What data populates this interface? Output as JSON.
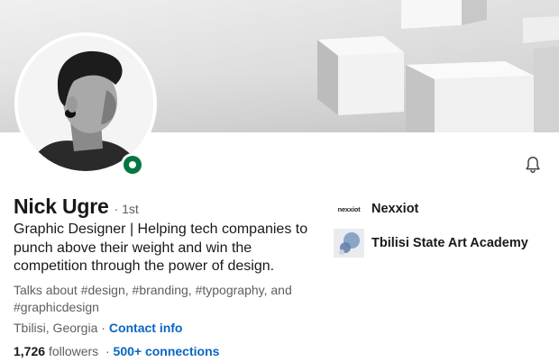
{
  "profile": {
    "name": "Nick Ugre",
    "degree": "· 1st",
    "headline": "Graphic Designer | Helping tech companies to punch above their weight and win the competition through the power of design.",
    "talks_about": "Talks about #design, #branding, #typography, and #graphicdesign",
    "location": "Tbilisi, Georgia",
    "location_sep": "·",
    "contact_label": "Contact info",
    "followers_count": "1,726",
    "followers_label": "followers",
    "stats_sep": "·",
    "connections_label": "500+ connections",
    "online": true
  },
  "experience": [
    {
      "logo_text": "nexxiot",
      "name": "Nexxiot",
      "logo_icon": "nexxiot-logo"
    },
    {
      "logo_text": "",
      "name": "Tbilisi State Art Academy",
      "logo_icon": "academy-logo"
    }
  ],
  "icons": {
    "notify": "bell-icon",
    "status": "online-status-icon"
  },
  "colors": {
    "link": "#0a66c2",
    "online": "#057642",
    "muted_text": "#5e5e5e",
    "primary_text": "#191919"
  }
}
